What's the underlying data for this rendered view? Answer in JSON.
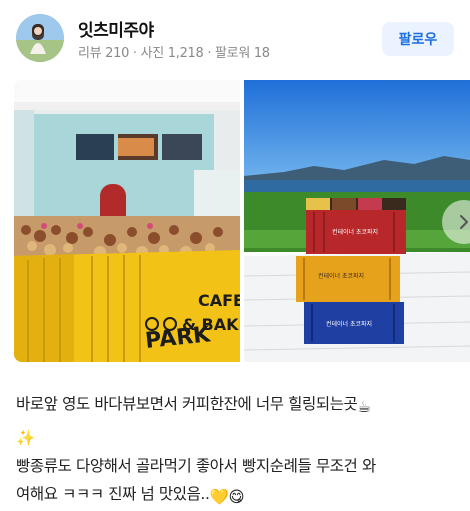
{
  "profile": {
    "name": "잇츠미주야",
    "reviews": "리뷰 210",
    "photos": "사진 1,218",
    "followers": "팔로워 18",
    "separator": "·",
    "avatar_icon": "user-avatar-photo"
  },
  "follow_button": {
    "label": "팔로우"
  },
  "gallery": {
    "photo1_sign_line1": "PARK",
    "photo1_sign_line2": "CAFE",
    "photo1_sign_line3": "& BAKE",
    "photo2_box_label": "컨테이너 초코파지",
    "next_icon": "chevron-right-icon"
  },
  "review": {
    "line1": "바로앞 영도 바다뷰보면서 커피한잔에 너무 힐링되는곳",
    "line1_emoji": "☕",
    "line2_emoji": "✨",
    "line3": "빵종류도 다양해서 골라먹기 좋아서 빵지순례들 무조건 와",
    "line4": "여해요 ㅋㅋㅋ 진짜 넘 맛있음..",
    "line4_emoji_heart": "💛",
    "line4_emoji_face": "😋"
  },
  "colors": {
    "follow_text": "#1d6fe0",
    "follow_bg": "#eaf3ff",
    "stats_text": "#8a8a8a"
  }
}
